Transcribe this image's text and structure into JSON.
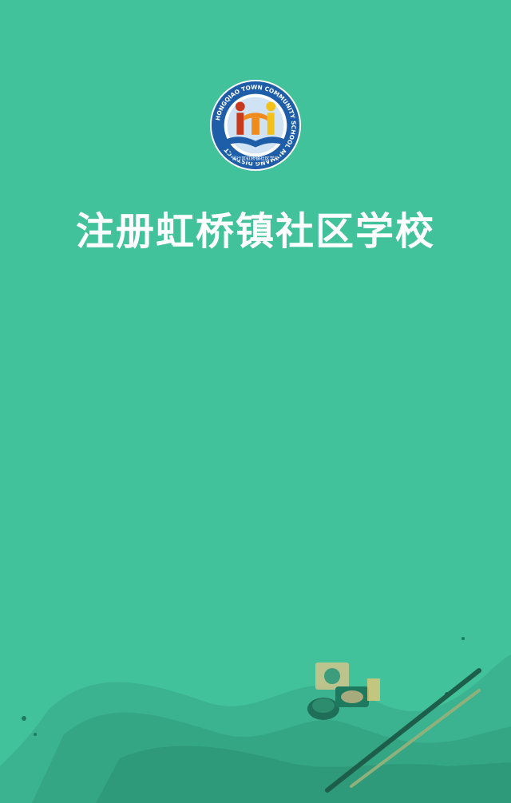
{
  "page": {
    "title": "注册虹桥镇社区学校"
  },
  "logo": {
    "ring_text": "HONGQIAO TOWN COMMUNITY SCHOOL MINHANG DISTRICT",
    "bottom_text": "闵行区虹桥镇社区学校",
    "icon": "school-logo-icon"
  },
  "decoration": {
    "icon": "ink-brush-painting-icon"
  },
  "colors": {
    "background": "#42c29b",
    "logo_ring": "#1e5ea8",
    "logo_orange": "#f08c1e",
    "logo_red": "#c83a1e",
    "logo_yellow": "#f2c21a",
    "ink_dark": "#1f8a6c"
  }
}
